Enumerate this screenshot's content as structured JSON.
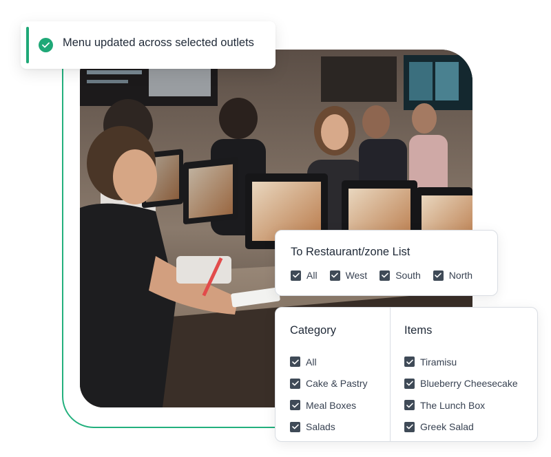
{
  "toast": {
    "message": "Menu updated across selected outlets",
    "status_color": "#1fa877",
    "icon": "check-circle-icon"
  },
  "zone_panel": {
    "title": "To Restaurant/zone List",
    "options": [
      {
        "label": "All",
        "checked": true
      },
      {
        "label": "West",
        "checked": true
      },
      {
        "label": "South",
        "checked": true
      },
      {
        "label": "North",
        "checked": true
      }
    ]
  },
  "category_panel": {
    "title": "Category",
    "options": [
      {
        "label": "All",
        "checked": true
      },
      {
        "label": "Cake & Pastry",
        "checked": true
      },
      {
        "label": "Meal Boxes",
        "checked": true
      },
      {
        "label": "Salads",
        "checked": true
      }
    ]
  },
  "items_panel": {
    "title": "Items",
    "options": [
      {
        "label": "Tiramisu",
        "checked": true
      },
      {
        "label": "Blueberry Cheesecake",
        "checked": true
      },
      {
        "label": "The Lunch Box",
        "checked": true
      },
      {
        "label": "Greek Salad",
        "checked": true
      }
    ]
  },
  "colors": {
    "accent": "#22b07d",
    "checkbox": "#3f4a57"
  }
}
